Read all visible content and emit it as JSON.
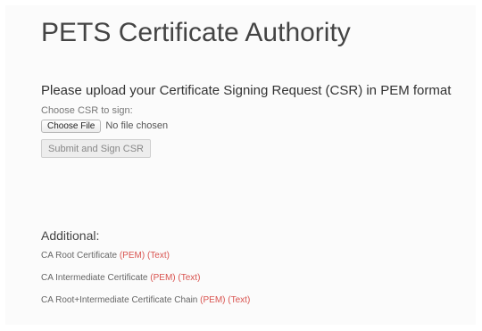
{
  "page": {
    "title": "PETS Certificate Authority"
  },
  "upload": {
    "heading": "Please upload your Certificate Signing Request (CSR) in PEM format",
    "choose_label": "Choose CSR to sign:",
    "choose_file_button": "Choose File",
    "no_file_text": "No file chosen",
    "submit_button": "Submit and Sign CSR"
  },
  "additional": {
    "heading": "Additional:",
    "items": [
      {
        "label": "CA Root Certificate",
        "links": [
          "(PEM)",
          "(Text)"
        ]
      },
      {
        "label": "CA Intermediate Certificate",
        "links": [
          "(PEM)",
          "(Text)"
        ]
      },
      {
        "label": "CA Root+Intermediate Certificate Chain",
        "links": [
          "(PEM)",
          "(Text)"
        ]
      }
    ]
  },
  "colors": {
    "link": "#d9534f",
    "background": "#fbfbfb",
    "title_text": "#444444"
  }
}
